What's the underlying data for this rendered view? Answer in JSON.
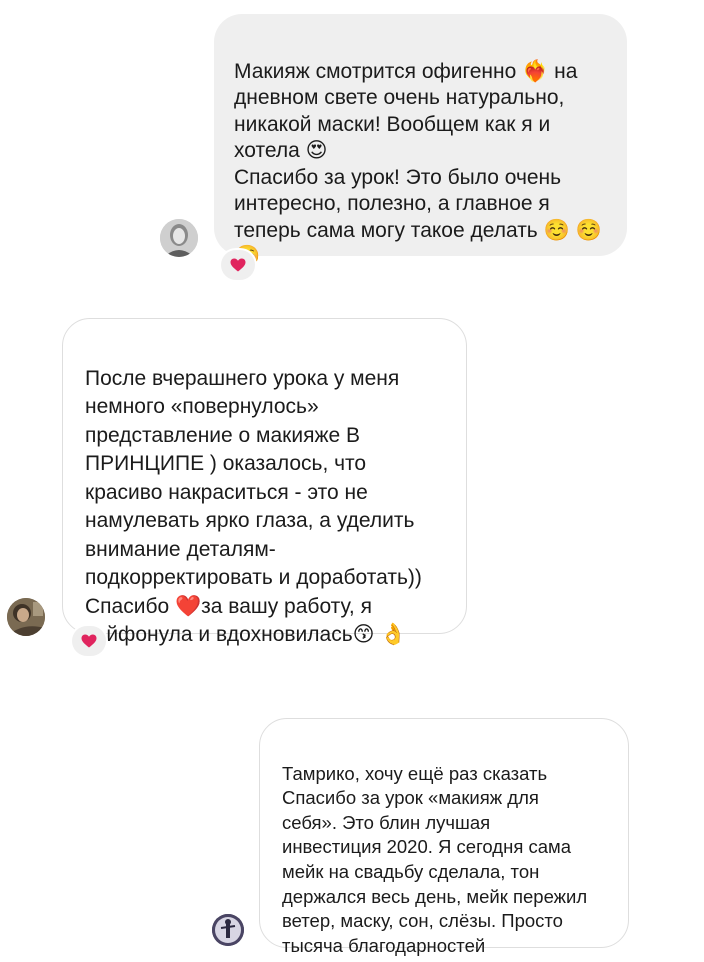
{
  "messages": [
    {
      "text": "Макияж смотрится офигенно ❤️‍🔥 на\nдневном свете очень натурально,\nникакой маски! Вообщем как я и\nхотела 😍\nСпасибо за урок! Это было очень\nинтересно, полезно, а главное я\nтеперь сама могу такое делать ☺️ ☺️\n☺️",
      "reaction": "❤️"
    },
    {
      "text": "После вчерашнего урока у меня\nнемного «повернулось»\nпредставление о макияже  В\nПРИНЦИПЕ ) оказалось, что\nкрасиво накраситься - это не\nнамулевать ярко глаза, а уделить\nвнимание деталям-\nподкорректировать и доработать))\nСпасибо ❤️за вашу работу, я\nкайфонула и вдохновилась😙 👌",
      "reaction": "❤️"
    },
    {
      "text": "Тамрико, хочу ещё раз сказать\nСпасибо за урок «макияж для\nсебя». Это блин лучшая\nинвестиция 2020. Я сегодня сама\nмейк на свадьбу сделала, тон\nдержался весь день, мейк пережил\nветер, маску, сон, слёзы. Просто\nтысяча благодарностей"
    }
  ],
  "colors": {
    "bubble_fill": "#efefef",
    "bubble_border": "#dedede",
    "text": "#1b1b1b",
    "heart": "#e0245e"
  }
}
